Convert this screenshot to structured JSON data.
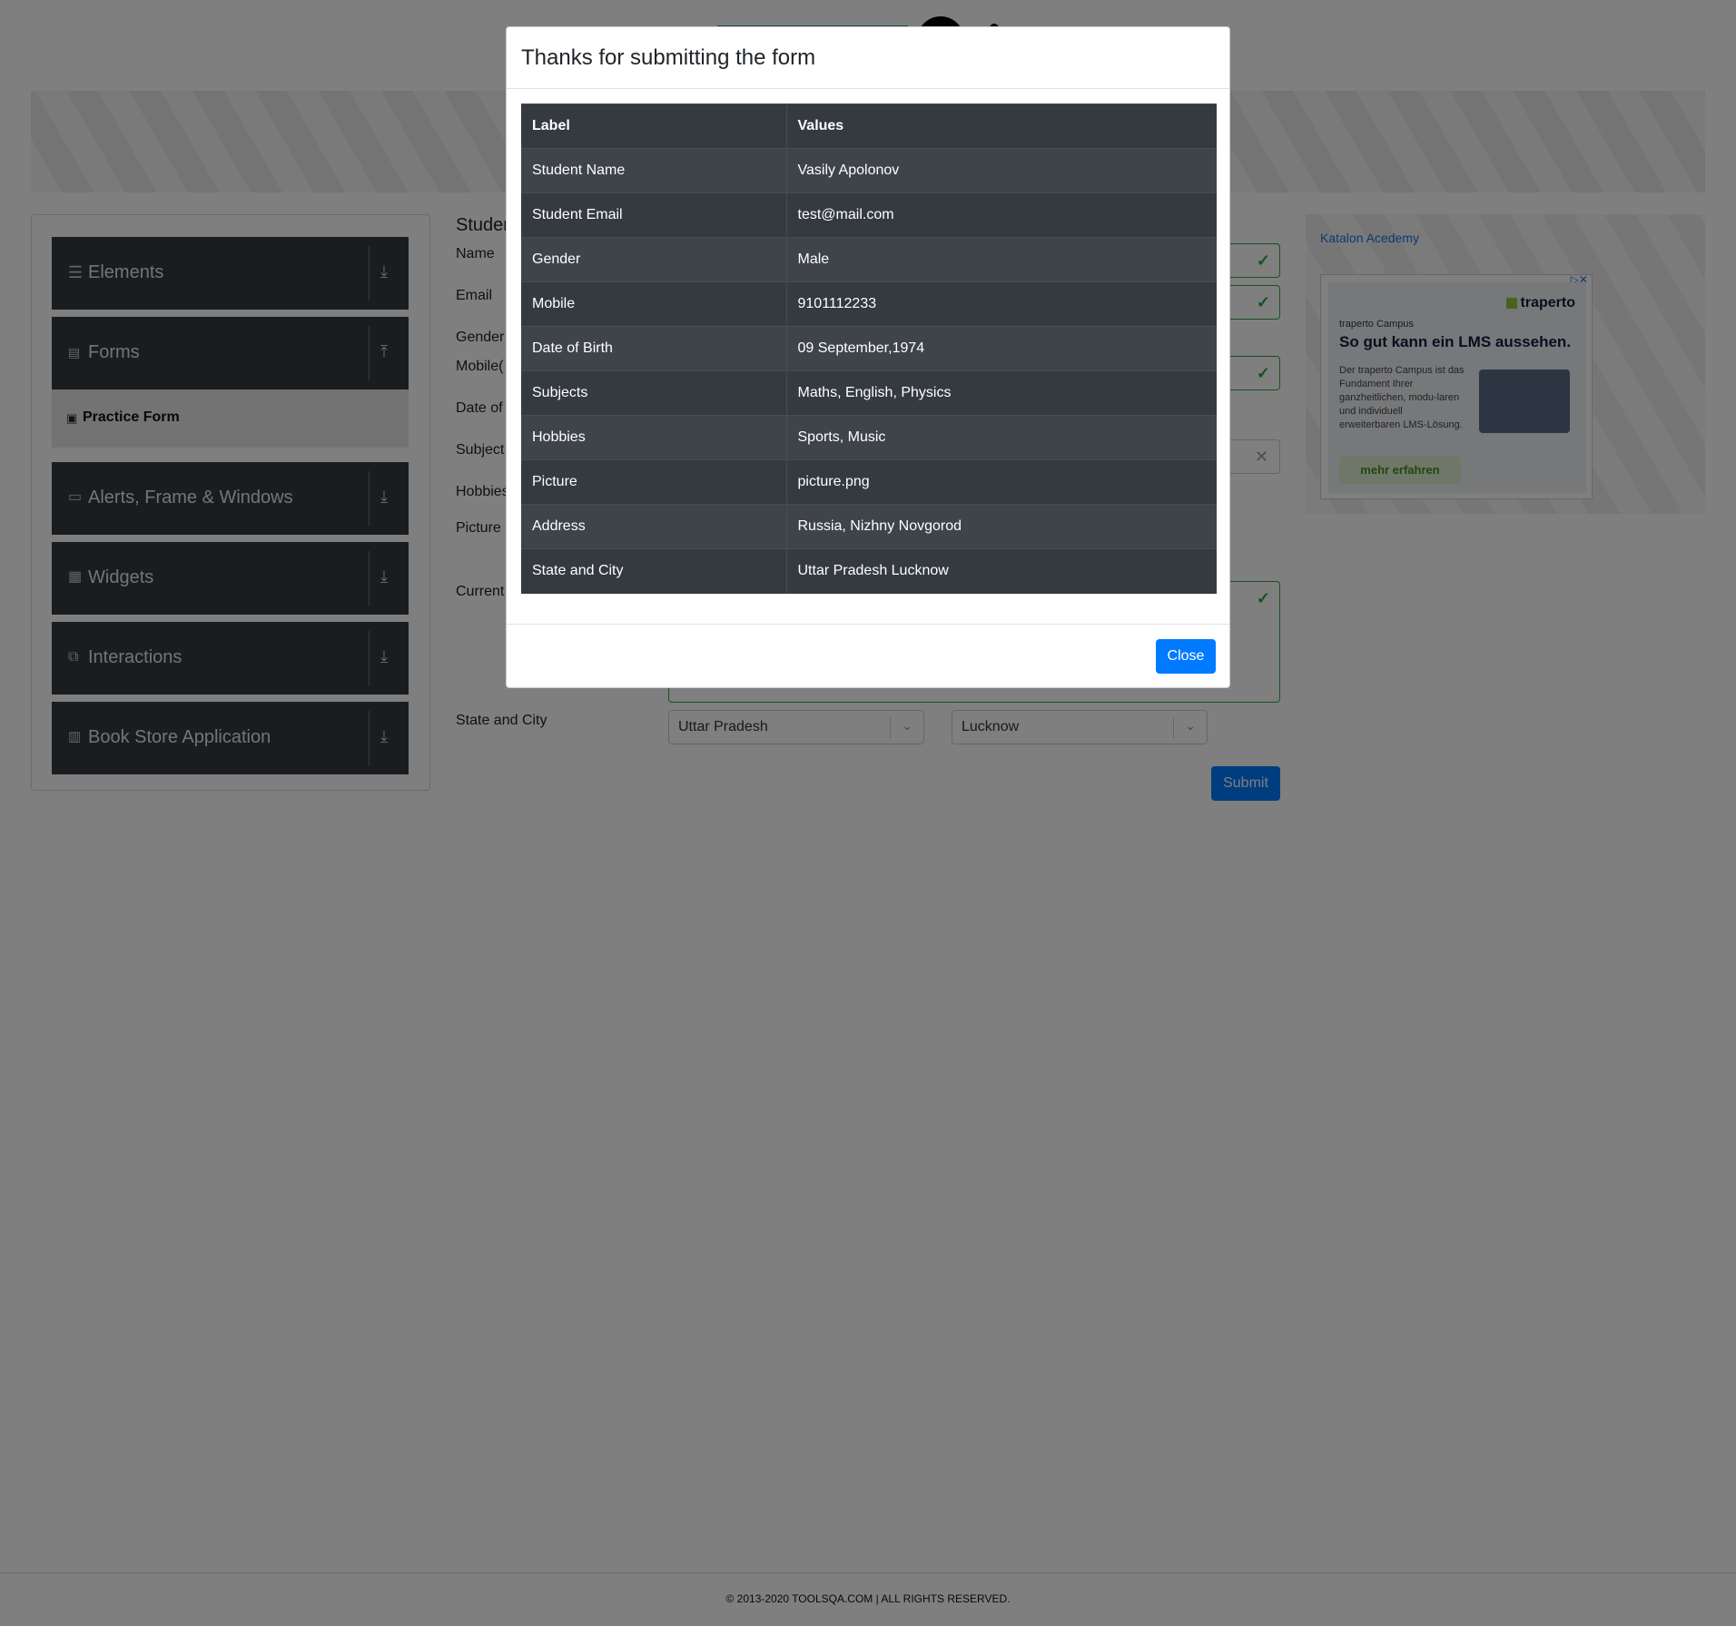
{
  "sidebar": {
    "groups": [
      {
        "label": "Elements",
        "icon": "list-icon"
      },
      {
        "label": "Forms",
        "icon": "document-icon"
      },
      {
        "label": "Alerts, Frame & Windows",
        "icon": "window-icon"
      },
      {
        "label": "Widgets",
        "icon": "grid-icon"
      },
      {
        "label": "Interactions",
        "icon": "interaction-icon"
      },
      {
        "label": "Book Store Application",
        "icon": "books-icon"
      }
    ],
    "active_item": "Practice Form"
  },
  "form": {
    "title_partial": "Studen",
    "labels": {
      "name": "Name",
      "email": "Email",
      "gender": "Gender",
      "mobile": "Mobile(",
      "dob": "Date of",
      "subjects": "Subject",
      "hobbies": "Hobbies",
      "picture": "Picture",
      "address": "Current",
      "state_city": "State and City"
    },
    "state_value": "Uttar Pradesh",
    "city_value": "Lucknow",
    "submit_label": "Submit"
  },
  "ad": {
    "link_text": "Katalon Acedemy",
    "brand": "traperto",
    "small": "traperto Campus",
    "headline": "So gut kann ein LMS aussehen.",
    "body": "Der traperto Campus ist das Fundament Ihrer ganzheitlichen, modu-laren und individuell erweiterbaren LMS-Lösung.",
    "cta": "mehr erfahren"
  },
  "footer": "© 2013-2020 TOOLSQA.COM | ALL RIGHTS RESERVED.",
  "modal": {
    "title": "Thanks for submitting the form",
    "headers": [
      "Label",
      "Values"
    ],
    "rows": [
      [
        "Student Name",
        "Vasily Apolonov"
      ],
      [
        "Student Email",
        "test@mail.com"
      ],
      [
        "Gender",
        "Male"
      ],
      [
        "Mobile",
        "9101112233"
      ],
      [
        "Date of Birth",
        "09 September,1974"
      ],
      [
        "Subjects",
        "Maths, English, Physics"
      ],
      [
        "Hobbies",
        "Sports, Music"
      ],
      [
        "Picture",
        "picture.png"
      ],
      [
        "Address",
        "Russia, Nizhny Novgorod"
      ],
      [
        "State and City",
        "Uttar Pradesh Lucknow"
      ]
    ],
    "close_label": "Close"
  },
  "colors": {
    "primary": "#007bff",
    "dark": "#343a40",
    "success": "#28a745"
  }
}
